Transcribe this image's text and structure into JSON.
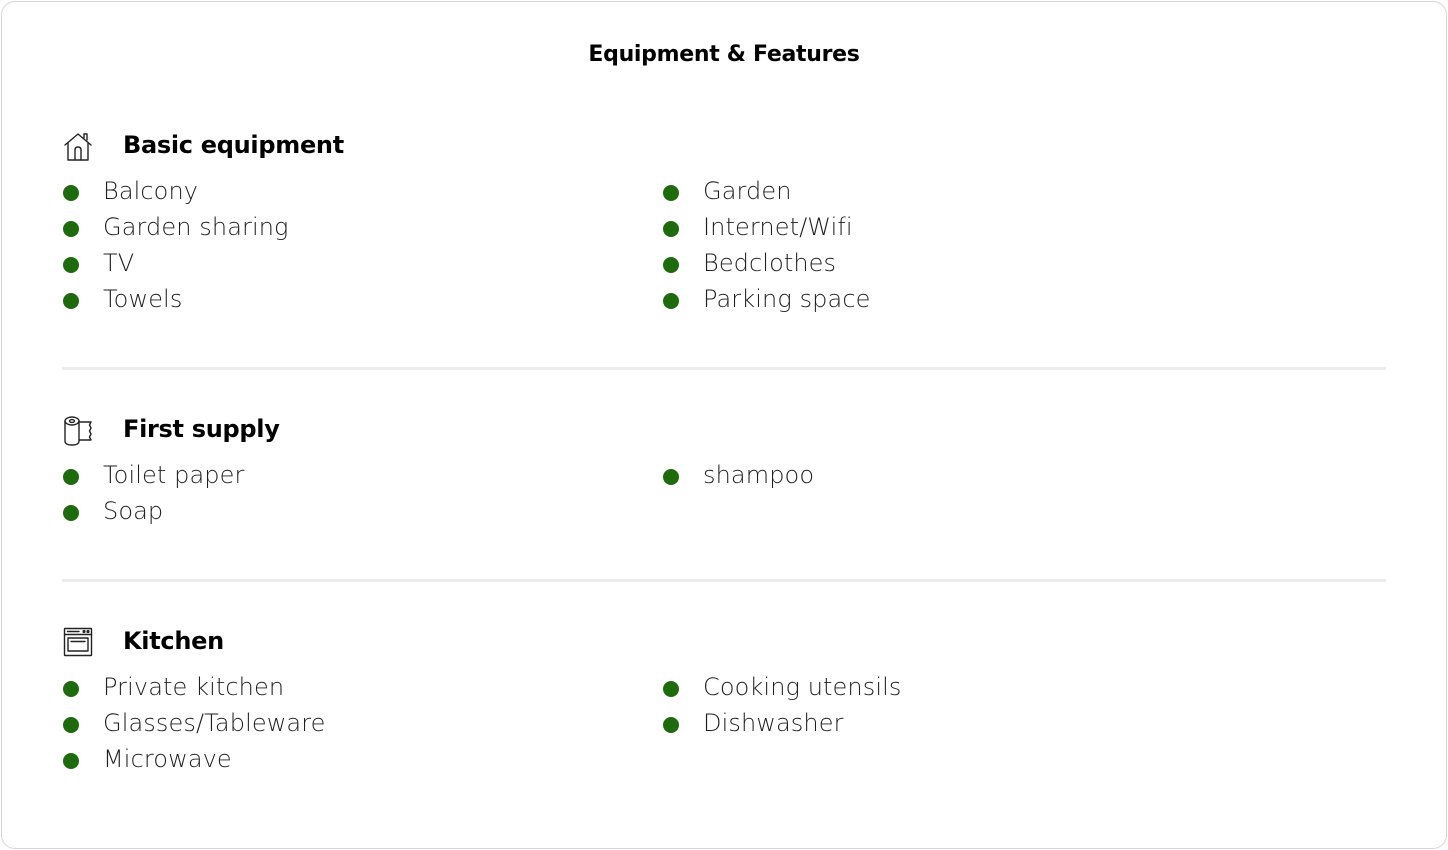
{
  "title": "Equipment & Features",
  "accent_color": "#1e6b0e",
  "sections": [
    {
      "icon": "house-icon",
      "title": "Basic equipment",
      "left": [
        "Balcony",
        "Garden sharing",
        "TV",
        "Towels"
      ],
      "right": [
        "Garden",
        "Internet/Wifi",
        "Bedclothes",
        "Parking space"
      ]
    },
    {
      "icon": "toilet-paper-icon",
      "title": "First supply",
      "left": [
        "Toilet paper",
        "Soap"
      ],
      "right": [
        "shampoo"
      ]
    },
    {
      "icon": "oven-icon",
      "title": "Kitchen",
      "left": [
        "Private kitchen",
        "Glasses/Tableware",
        "Microwave"
      ],
      "right": [
        "Cooking utensils",
        "Dishwasher"
      ]
    }
  ]
}
